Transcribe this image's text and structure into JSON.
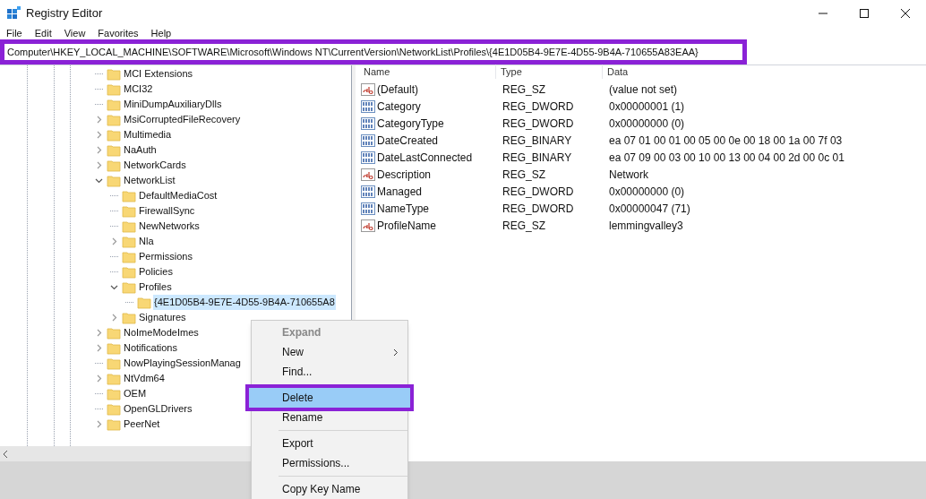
{
  "window": {
    "title": "Registry Editor"
  },
  "menu": [
    "File",
    "Edit",
    "View",
    "Favorites",
    "Help"
  ],
  "address_bar": {
    "value": "Computer\\HKEY_LOCAL_MACHINE\\SOFTWARE\\Microsoft\\Windows NT\\CurrentVersion\\NetworkList\\Profiles\\{4E1D05B4-9E7E-4D55-9B4A-710655A83EAA}",
    "annotated": true
  },
  "tree": [
    {
      "label": "MCI Extensions",
      "selected": false
    },
    {
      "label": "MCI32",
      "selected": false
    },
    {
      "label": "MiniDumpAuxiliaryDlls",
      "selected": false
    },
    {
      "label": "MsiCorruptedFileRecovery",
      "expanded": false,
      "selected": false
    },
    {
      "label": "Multimedia",
      "expanded": false,
      "selected": false
    },
    {
      "label": "NaAuth",
      "expanded": false,
      "selected": false
    },
    {
      "label": "NetworkCards",
      "expanded": false,
      "selected": false
    },
    {
      "label": "NetworkList",
      "expanded": true,
      "selected": false,
      "children": [
        {
          "label": "DefaultMediaCost",
          "selected": false
        },
        {
          "label": "FirewallSync",
          "selected": false
        },
        {
          "label": "NewNetworks",
          "selected": false
        },
        {
          "label": "Nla",
          "expanded": false,
          "selected": false
        },
        {
          "label": "Permissions",
          "selected": false
        },
        {
          "label": "Policies",
          "selected": false
        },
        {
          "label": "Profiles",
          "expanded": true,
          "selected": false,
          "children": [
            {
              "label": "{4E1D05B4-9E7E-4D55-9B4A-710655A8",
              "selected": true
            }
          ]
        },
        {
          "label": "Signatures",
          "expanded": false,
          "selected": false
        }
      ]
    },
    {
      "label": "NoImeModeImes",
      "expanded": false,
      "selected": false
    },
    {
      "label": "Notifications",
      "expanded": false,
      "selected": false
    },
    {
      "label": "NowPlayingSessionManag",
      "selected": false
    },
    {
      "label": "NtVdm64",
      "expanded": false,
      "selected": false
    },
    {
      "label": "OEM",
      "selected": false
    },
    {
      "label": "OpenGLDrivers",
      "selected": false
    },
    {
      "label": "PeerNet",
      "expanded": false,
      "selected": false
    }
  ],
  "values": {
    "columns": [
      "Name",
      "Type",
      "Data"
    ],
    "rows": [
      {
        "kind": "string",
        "name": "(Default)",
        "type": "REG_SZ",
        "data": "(value not set)"
      },
      {
        "kind": "binary",
        "name": "Category",
        "type": "REG_DWORD",
        "data": "0x00000001 (1)"
      },
      {
        "kind": "binary",
        "name": "CategoryType",
        "type": "REG_DWORD",
        "data": "0x00000000 (0)"
      },
      {
        "kind": "binary",
        "name": "DateCreated",
        "type": "REG_BINARY",
        "data": "ea 07 01 00 01 00 05 00 0e 00 18 00 1a 00 7f 03"
      },
      {
        "kind": "binary",
        "name": "DateLastConnected",
        "type": "REG_BINARY",
        "data": "ea 07 09 00 03 00 10 00 13 00 04 00 2d 00 0c 01"
      },
      {
        "kind": "string",
        "name": "Description",
        "type": "REG_SZ",
        "data": "Network"
      },
      {
        "kind": "binary",
        "name": "Managed",
        "type": "REG_DWORD",
        "data": "0x00000000 (0)"
      },
      {
        "kind": "binary",
        "name": "NameType",
        "type": "REG_DWORD",
        "data": "0x00000047 (71)"
      },
      {
        "kind": "string",
        "name": "ProfileName",
        "type": "REG_SZ",
        "data": "lemmingvalley3"
      }
    ]
  },
  "context_menu": [
    {
      "kind": "item",
      "label": "Expand",
      "disabled": true,
      "bold": true,
      "submenu": false,
      "highlighted": false,
      "annotated": false
    },
    {
      "kind": "item",
      "label": "New",
      "disabled": false,
      "bold": false,
      "submenu": true,
      "highlighted": false,
      "annotated": false
    },
    {
      "kind": "item",
      "label": "Find...",
      "disabled": false,
      "bold": false,
      "submenu": false,
      "highlighted": false,
      "annotated": false
    },
    {
      "kind": "separator"
    },
    {
      "kind": "item",
      "label": "Delete",
      "disabled": false,
      "bold": false,
      "submenu": false,
      "highlighted": true,
      "annotated": true
    },
    {
      "kind": "item",
      "label": "Rename",
      "disabled": false,
      "bold": false,
      "submenu": false,
      "highlighted": false,
      "annotated": false
    },
    {
      "kind": "separator"
    },
    {
      "kind": "item",
      "label": "Export",
      "disabled": false,
      "bold": false,
      "submenu": false,
      "highlighted": false,
      "annotated": false
    },
    {
      "kind": "item",
      "label": "Permissions...",
      "disabled": false,
      "bold": false,
      "submenu": false,
      "highlighted": false,
      "annotated": false
    },
    {
      "kind": "separator"
    },
    {
      "kind": "item",
      "label": "Copy Key Name",
      "disabled": false,
      "bold": false,
      "submenu": false,
      "highlighted": false,
      "annotated": false
    }
  ]
}
